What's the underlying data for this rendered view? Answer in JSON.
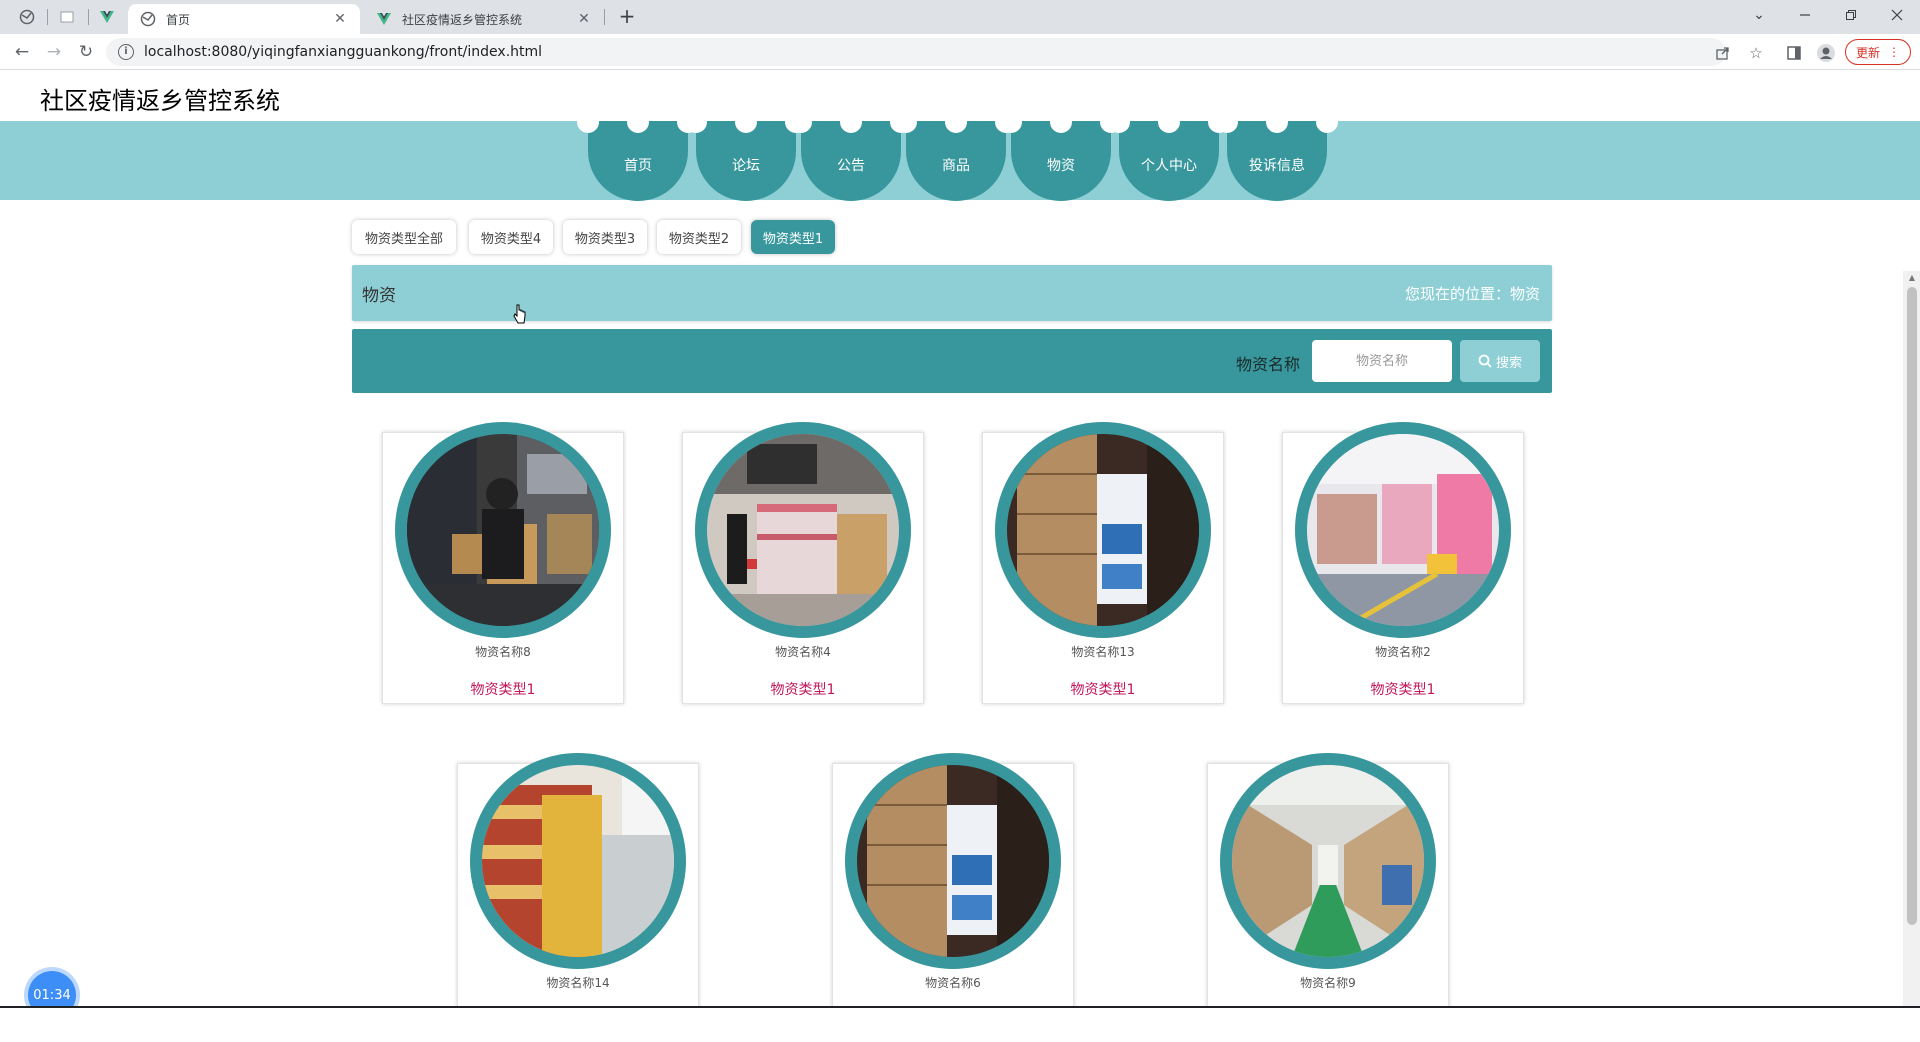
{
  "browser": {
    "tabs": [
      {
        "title": "首页",
        "active": true
      },
      {
        "title": "社区疫情返乡管控系统",
        "active": false
      }
    ],
    "url": "localhost:8080/yiqingfanxiangguankong/front/index.html",
    "update_label": "更新"
  },
  "site": {
    "title": "社区疫情返乡管控系统",
    "nav": [
      "首页",
      "论坛",
      "公告",
      "商品",
      "物资",
      "个人中心",
      "投诉信息"
    ]
  },
  "filters": {
    "items": [
      "物资类型全部",
      "物资类型4",
      "物资类型3",
      "物资类型2",
      "物资类型1"
    ],
    "active": "物资类型1"
  },
  "breadcrumb": {
    "title": "物资",
    "position": "您现在的位置：物资"
  },
  "search": {
    "label": "物资名称",
    "placeholder": "物资名称",
    "button": "搜索"
  },
  "items": [
    {
      "name": "物资名称8",
      "type": "物资类型1"
    },
    {
      "name": "物资名称4",
      "type": "物资类型1"
    },
    {
      "name": "物资名称13",
      "type": "物资类型1"
    },
    {
      "name": "物资名称2",
      "type": "物资类型1"
    },
    {
      "name": "物资名称14",
      "type": ""
    },
    {
      "name": "物资名称6",
      "type": ""
    },
    {
      "name": "物资名称9",
      "type": ""
    }
  ],
  "timer": "01:34",
  "colors": {
    "nav_band": "#8ecfd6",
    "nav_item": "#38979c",
    "type_text": "#c2185b",
    "update_red": "#d93025"
  }
}
